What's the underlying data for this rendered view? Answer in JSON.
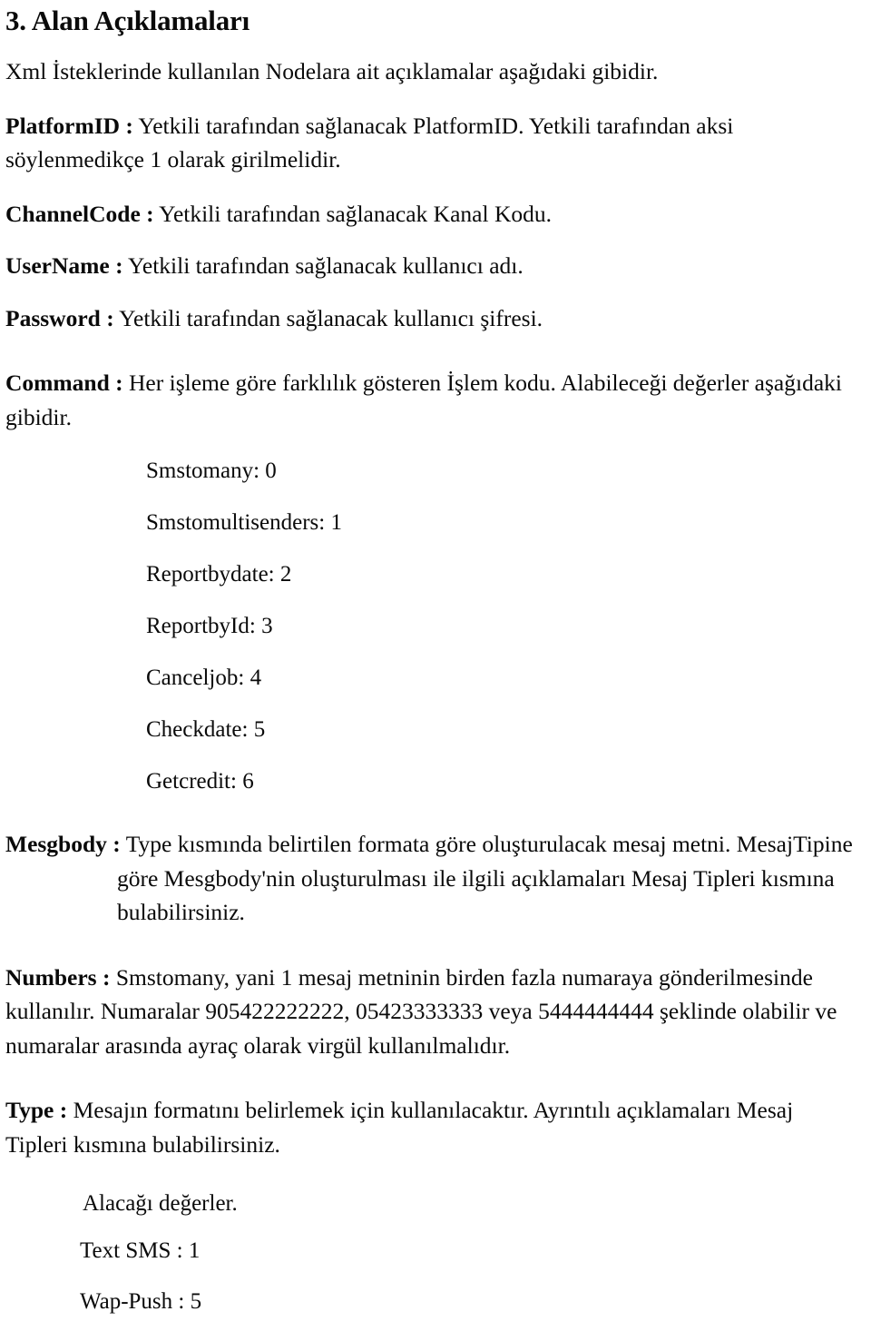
{
  "document": {
    "title": "3. Alan Açıklamaları",
    "intro": "Xml İsteklerinde kullanılan Nodelara ait açıklamalar aşağıdaki gibidir."
  },
  "fields": {
    "platform_id": {
      "label": "PlatformID :",
      "description": " Yetkili tarafından sağlanacak PlatformID. Yetkili tarafından aksi söylenmedikçe 1 olarak girilmelidir."
    },
    "channel_code": {
      "label": "ChannelCode :",
      "description": " Yetkili tarafından sağlanacak Kanal Kodu."
    },
    "user_name": {
      "label": "UserName :",
      "description": " Yetkili tarafından sağlanacak kullanıcı adı."
    },
    "password": {
      "label": "Password :",
      "description": " Yetkili tarafından sağlanacak kullanıcı şifresi."
    },
    "command": {
      "label": "Command :",
      "description": " Her işleme göre farklılık gösteren İşlem kodu. Alabileceği değerler aşağıdaki gibidir."
    },
    "mesgbody": {
      "label": "Mesgbody :",
      "description": " Type kısmında belirtilen formata göre oluşturulacak mesaj metni. MesajTipine göre Mesgbody'nin oluşturulması ile ilgili açıklamaları Mesaj Tipleri kısmına bulabilirsiniz."
    },
    "numbers": {
      "label": "Numbers :",
      "description": " Smstomany, yani 1 mesaj metninin birden fazla numaraya gönderilmesinde kullanılır. Numaralar 905422222222, 05423333333 veya 5444444444 şeklinde olabilir ve numaralar arasında ayraç olarak virgül kullanılmalıdır."
    },
    "type": {
      "label": "Type :",
      "description": " Mesajın formatını belirlemek için kullanılacaktır. Ayrıntılı açıklamaları Mesaj Tipleri kısmına bulabilirsiniz."
    }
  },
  "command_values": [
    {
      "name": "Smstomany:",
      "value": "0"
    },
    {
      "name": "Smstomultisenders:",
      "value": "1"
    },
    {
      "name": "Reportbydate:",
      "value": "2"
    },
    {
      "name": "ReportbyId:",
      "value": "3"
    },
    {
      "name": "Canceljob:",
      "value": "4"
    },
    {
      "name": "Checkdate:",
      "value": "5"
    },
    {
      "name": "Getcredit:",
      "value": "6"
    }
  ],
  "type_values": {
    "intro": "Alacağı değerler.",
    "items": [
      {
        "name": "Text SMS :",
        "value": "1"
      },
      {
        "name": "Wap-Push :",
        "value": "5"
      }
    ]
  }
}
